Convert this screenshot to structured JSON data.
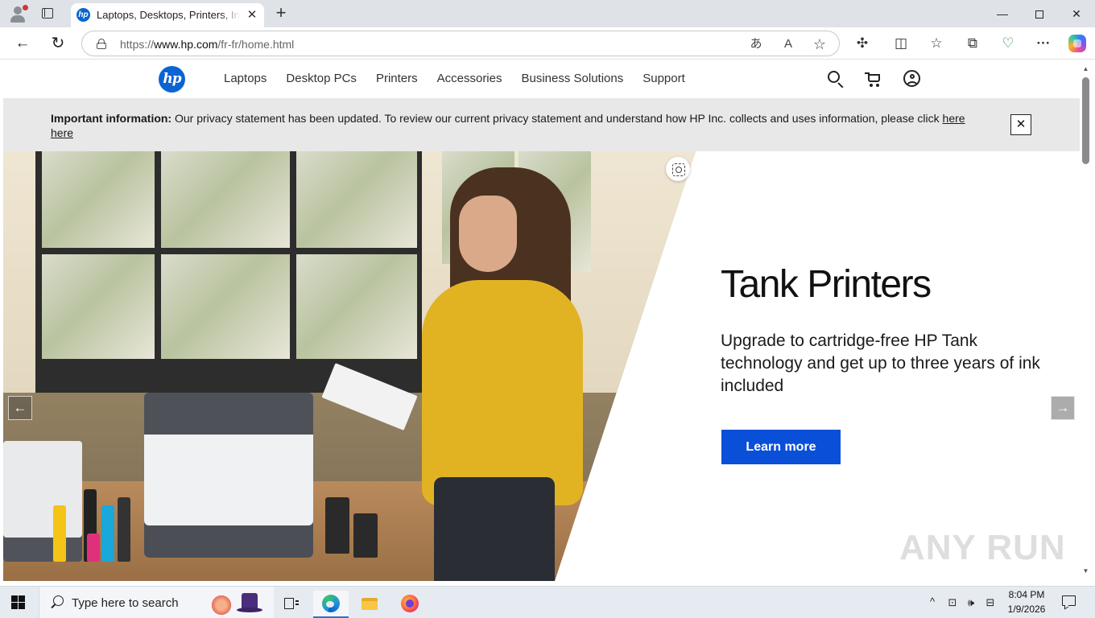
{
  "browser": {
    "tab_title": "Laptops, Desktops, Printers, Ink & Toner | HP® Official Site",
    "tab_close": "✕",
    "new_tab": "+",
    "url_scheme": "https://",
    "url_host": "www.hp.com",
    "url_path": "/fr-fr/home.html",
    "window": {
      "minimize": "—",
      "close": "✕"
    },
    "toolbar_icons": {
      "back": "←",
      "reload": "↻",
      "translate": "あ",
      "read_aloud": "A",
      "favorite": "☆",
      "extensions": "✣",
      "split": "◫",
      "favorites": "☆",
      "collections": "⧉",
      "performance": "♡",
      "more": "···"
    }
  },
  "site": {
    "logo_text": "hp",
    "nav": [
      "Laptops",
      "Desktop PCs",
      "Printers",
      "Accessories",
      "Business Solutions",
      "Support"
    ]
  },
  "infobar": {
    "label": "Important information:",
    "text": " Our privacy statement has been updated. To review our current privacy statement and understand how HP Inc. collects and uses information, please click ",
    "link": "here here",
    "close": "✕"
  },
  "hero": {
    "title": "Tank Printers",
    "subtitle": "Upgrade to cartridge-free HP Tank technology and get up to three years of ink included",
    "cta": "Learn more",
    "prev": "←",
    "next": "→"
  },
  "watermark": "ANY RUN",
  "scrollbar": {
    "up": "▲",
    "down": "▼"
  },
  "taskbar": {
    "search_placeholder": "Type here to search",
    "tray": {
      "chevron": "^",
      "meet": "⊡",
      "volume": "🕪",
      "network": "⊟"
    },
    "time": "8:04 PM",
    "date": "1/9/2026"
  },
  "colors": {
    "hp_blue": "#0a64d2",
    "cta_blue": "#0a4fd8",
    "infobar_bg": "#e8e8e8",
    "taskbar_bg": "#e6ebf1"
  }
}
